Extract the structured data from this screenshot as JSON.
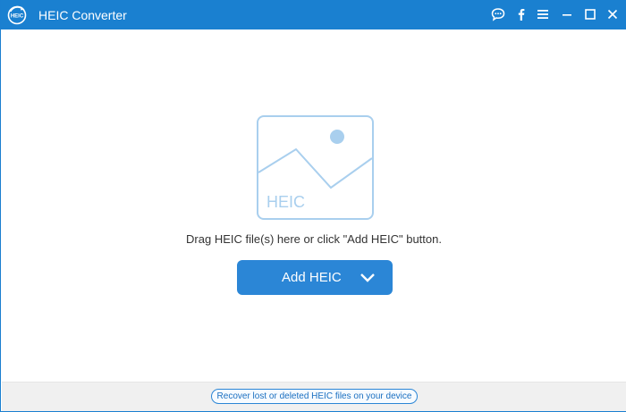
{
  "window": {
    "title": "HEIC Converter",
    "logo_text": "HEIC",
    "accent_color": "#1a80d0"
  },
  "titlebar_icons": [
    {
      "name": "feedback-icon"
    },
    {
      "name": "facebook-icon"
    },
    {
      "name": "menu-icon"
    },
    {
      "name": "minimize-icon"
    },
    {
      "name": "maximize-icon"
    },
    {
      "name": "close-icon"
    }
  ],
  "main": {
    "drop_icon_label": "HEIC",
    "drop_hint": "Drag HEIC file(s) here or click \"Add HEIC\" button.",
    "add_button_label": "Add HEIC",
    "button_color": "#2b86d6"
  },
  "footer": {
    "recover_link": "Recover lost or deleted HEIC files on your device"
  }
}
